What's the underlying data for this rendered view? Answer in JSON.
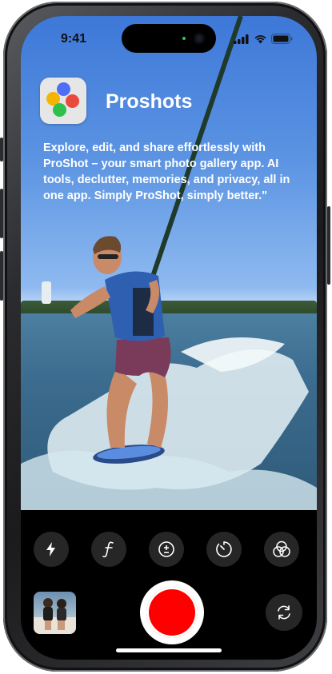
{
  "status_bar": {
    "time": "9:41"
  },
  "app": {
    "name": "Proshots",
    "description": "Explore, edit, and share effortlessly with ProShot – your smart photo gallery app. AI tools, declutter, memories, and privacy, all in one app. Simply ProShot, simply better.\"",
    "icon_dot_colors": [
      "#4f6ef7",
      "#f4b400",
      "#ea4a3c",
      "#2ec04a"
    ]
  },
  "camera_controls": {
    "icons": [
      "flash-icon",
      "aperture-f-icon",
      "exposure-icon",
      "timer-icon",
      "filters-icon"
    ],
    "shutter_color": "#ff0000"
  },
  "colors": {
    "screen_bg": "#000000",
    "control_bg": "#262626"
  }
}
